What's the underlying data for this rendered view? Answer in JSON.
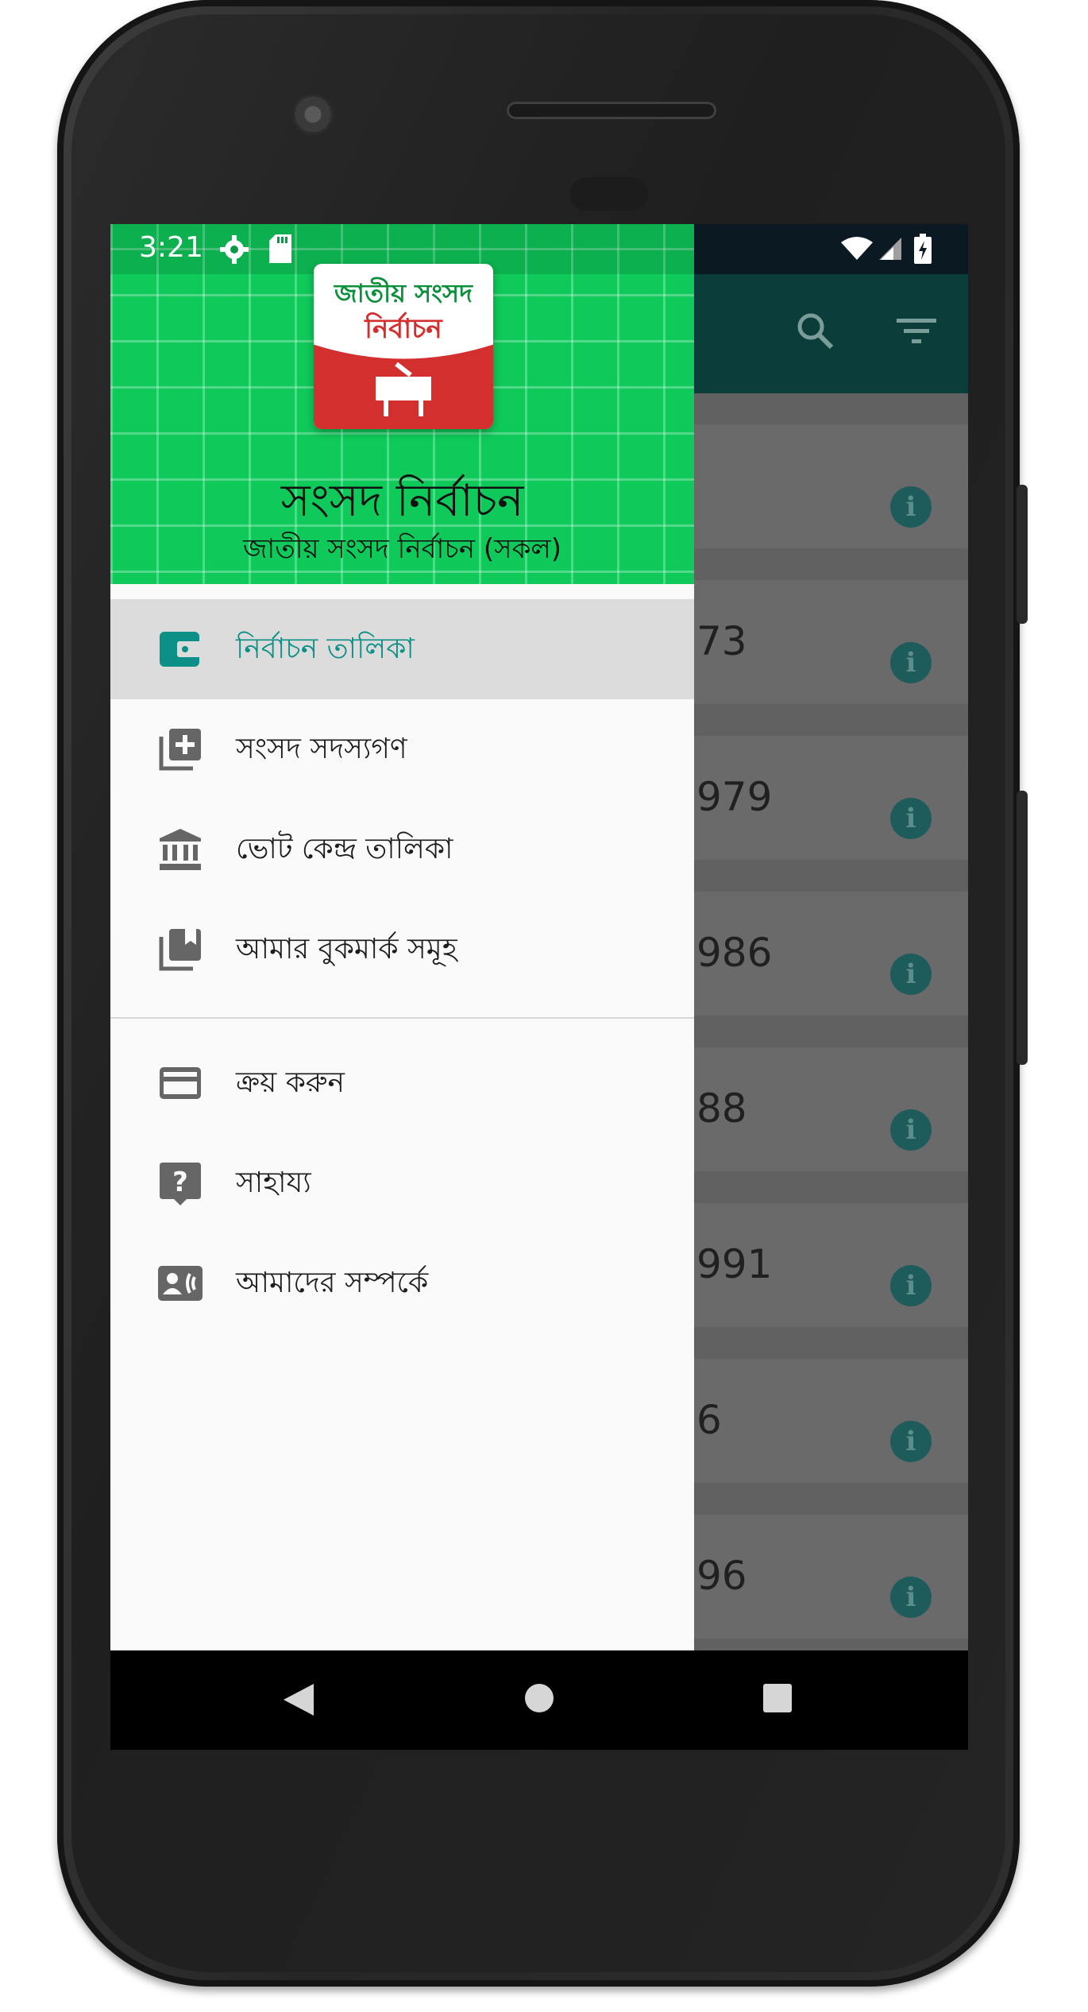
{
  "status_bar": {
    "time": "3:21"
  },
  "app": {
    "header_title": "সংসদ নির্বাচন",
    "header_subtitle": "জাতীয় সংসদ নির্বাচন (সকল)",
    "logo": {
      "line1": "জাতীয় সংসদ",
      "line2": "নির্বাচন"
    }
  },
  "menu": {
    "items": [
      {
        "label": "নির্বাচন তালিকা",
        "icon": "wallet-icon",
        "active": true
      },
      {
        "label": "সংসদ সদস্যগণ",
        "icon": "library-add-icon"
      },
      {
        "label": "ভোট কেন্দ্র তালিকা",
        "icon": "bank-building-icon"
      },
      {
        "label": "আমার বুকমার্ক সমূহ",
        "icon": "bookmarks-icon"
      }
    ],
    "secondary": [
      {
        "label": "ক্রয় করুন",
        "icon": "credit-card-icon"
      },
      {
        "label": "সাহায্য",
        "icon": "help-icon"
      },
      {
        "label": "আমাদের সম্পর্কে",
        "icon": "contact-card-icon"
      }
    ]
  },
  "background_list": {
    "visible_year_fragments": [
      "73",
      "979",
      "986",
      "88",
      "991",
      "6",
      "96"
    ]
  },
  "colors": {
    "header_green": "#0fc95a",
    "toolbar": "#0b3d3a",
    "accent": "#0b8f86",
    "logo_red": "#d32f2f"
  }
}
